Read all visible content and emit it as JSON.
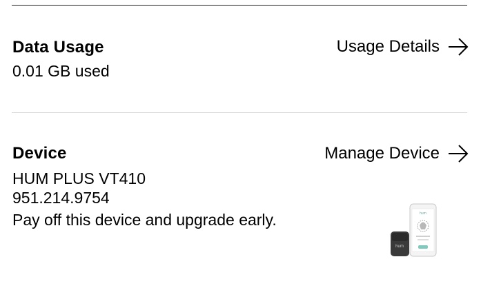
{
  "data_usage": {
    "title": "Data Usage",
    "value": "0.01 GB used",
    "link_label": "Usage Details"
  },
  "device": {
    "title": "Device",
    "name": "HUM PLUS VT410",
    "phone_number": "951.214.9754",
    "promo_text": "Pay off this device and upgrade early.",
    "link_label": "Manage Device",
    "image": {
      "brand_on_screen": "hum",
      "brand_on_device": "hum"
    }
  },
  "icons": {
    "link_arrow": "arrow-right-icon"
  }
}
